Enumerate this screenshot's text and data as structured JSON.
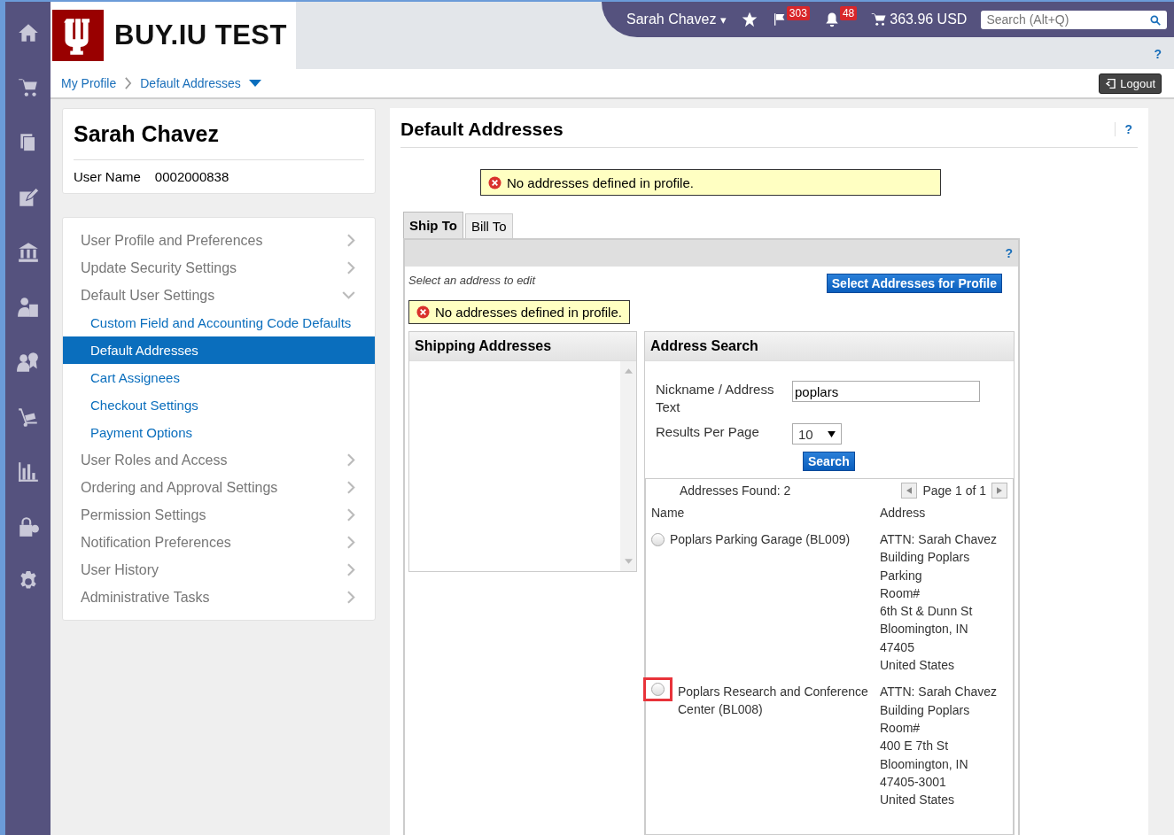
{
  "header": {
    "logo_text": "BUY.IU TEST",
    "user_menu": "Sarah Chavez",
    "user_menu_caret": "▾",
    "flag_count": "303",
    "bell_count": "48",
    "cart_total": "363.96 USD",
    "search": {
      "placeholder": "Search (Alt+Q)"
    },
    "help": "?"
  },
  "breadcrumb": {
    "items": [
      "My Profile",
      "Default Addresses"
    ],
    "logout": "Logout"
  },
  "profile": {
    "name": "Sarah Chavez",
    "user_name_label": "User Name",
    "user_name_value": "0002000838"
  },
  "menu": [
    {
      "kind": "section",
      "label": "User Profile and Preferences",
      "expanded": false
    },
    {
      "kind": "section",
      "label": "Update Security Settings",
      "expanded": false
    },
    {
      "kind": "section",
      "label": "Default User Settings",
      "expanded": true
    },
    {
      "kind": "sub",
      "label": "Custom Field and Accounting Code Defaults",
      "selected": false
    },
    {
      "kind": "sub",
      "label": "Default Addresses",
      "selected": true
    },
    {
      "kind": "sub",
      "label": "Cart Assignees",
      "selected": false
    },
    {
      "kind": "sub",
      "label": "Checkout Settings",
      "selected": false
    },
    {
      "kind": "sub",
      "label": "Payment Options",
      "selected": false
    },
    {
      "kind": "section",
      "label": "User Roles and Access",
      "expanded": false
    },
    {
      "kind": "section",
      "label": "Ordering and Approval Settings",
      "expanded": false
    },
    {
      "kind": "section",
      "label": "Permission Settings",
      "expanded": false
    },
    {
      "kind": "section",
      "label": "Notification Preferences",
      "expanded": false
    },
    {
      "kind": "section",
      "label": "User History",
      "expanded": false
    },
    {
      "kind": "section",
      "label": "Administrative Tasks",
      "expanded": false
    }
  ],
  "main": {
    "title": "Default Addresses",
    "help": "?",
    "alert": "No addresses defined in profile.",
    "tabs": [
      {
        "label": "Ship To",
        "selected": true
      },
      {
        "label": "Bill To",
        "selected": false
      }
    ],
    "panel_help": "?",
    "hint": "Select an address to edit",
    "select_button": "Select Addresses for Profile",
    "panel_alert": "No addresses defined in profile.",
    "shipping_title": "Shipping Addresses",
    "search_title": "Address Search",
    "nickname_label": "Nickname / Address Text",
    "nickname_value": "poplars",
    "results_label": "Results Per Page",
    "results_value": "10",
    "search_button": "Search",
    "found": "Addresses Found: 2",
    "page": "Page 1 of 1",
    "columns": [
      "Name",
      "Address"
    ],
    "results": [
      {
        "name": "Poplars Parking Garage (BL009)",
        "selected": false,
        "highlighted": false,
        "address": [
          "ATTN: Sarah Chavez",
          "Building Poplars",
          "Parking",
          "Room#",
          "6th St & Dunn St",
          "Bloomington, IN",
          "47405",
          "United States"
        ]
      },
      {
        "name": "Poplars Research and Conference Center (BL008)",
        "selected": false,
        "highlighted": true,
        "address": [
          "ATTN: Sarah Chavez",
          "Building Poplars",
          "Room#",
          "400 E 7th St",
          "Bloomington, IN",
          "47405-3001",
          "United States"
        ]
      }
    ]
  }
}
